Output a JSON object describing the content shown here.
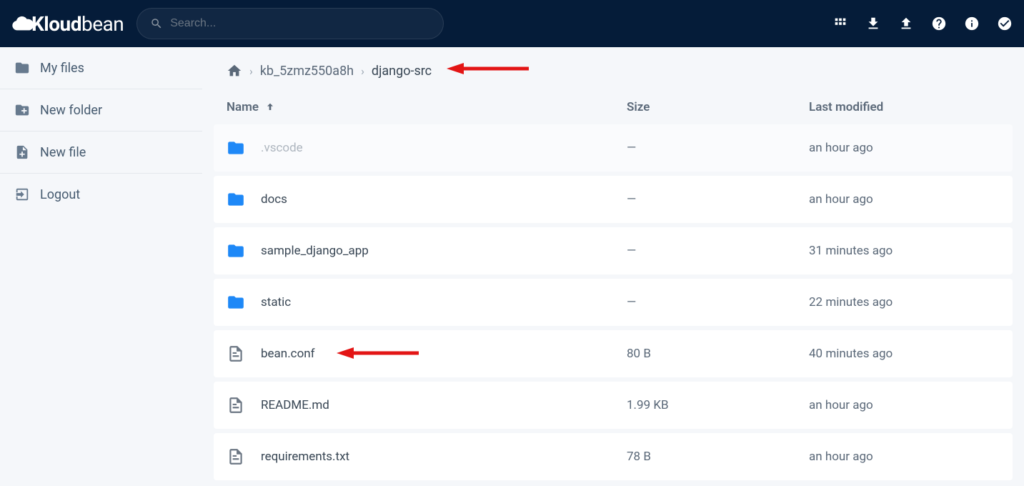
{
  "search": {
    "placeholder": "Search..."
  },
  "logo_text": "Kloudbean",
  "sidebar": {
    "items": [
      {
        "label": "My files"
      },
      {
        "label": "New folder"
      },
      {
        "label": "New file"
      },
      {
        "label": "Logout"
      }
    ]
  },
  "breadcrumb": {
    "items": [
      {
        "label": "kb_5zmz550a8h"
      },
      {
        "label": "django-src"
      }
    ]
  },
  "columns": {
    "name": "Name",
    "size": "Size",
    "modified": "Last modified"
  },
  "files": [
    {
      "name": ".vscode",
      "type": "folder",
      "size": "—",
      "modified": "an hour ago",
      "muted": true
    },
    {
      "name": "docs",
      "type": "folder",
      "size": "—",
      "modified": "an hour ago",
      "muted": false
    },
    {
      "name": "sample_django_app",
      "type": "folder",
      "size": "—",
      "modified": "31 minutes ago",
      "muted": false
    },
    {
      "name": "static",
      "type": "folder",
      "size": "—",
      "modified": "22 minutes ago",
      "muted": false
    },
    {
      "name": "bean.conf",
      "type": "file",
      "size": "80 B",
      "modified": "40 minutes ago",
      "muted": false
    },
    {
      "name": "README.md",
      "type": "file",
      "size": "1.99 KB",
      "modified": "an hour ago",
      "muted": false
    },
    {
      "name": "requirements.txt",
      "type": "file",
      "size": "78 B",
      "modified": "an hour ago",
      "muted": false
    }
  ]
}
